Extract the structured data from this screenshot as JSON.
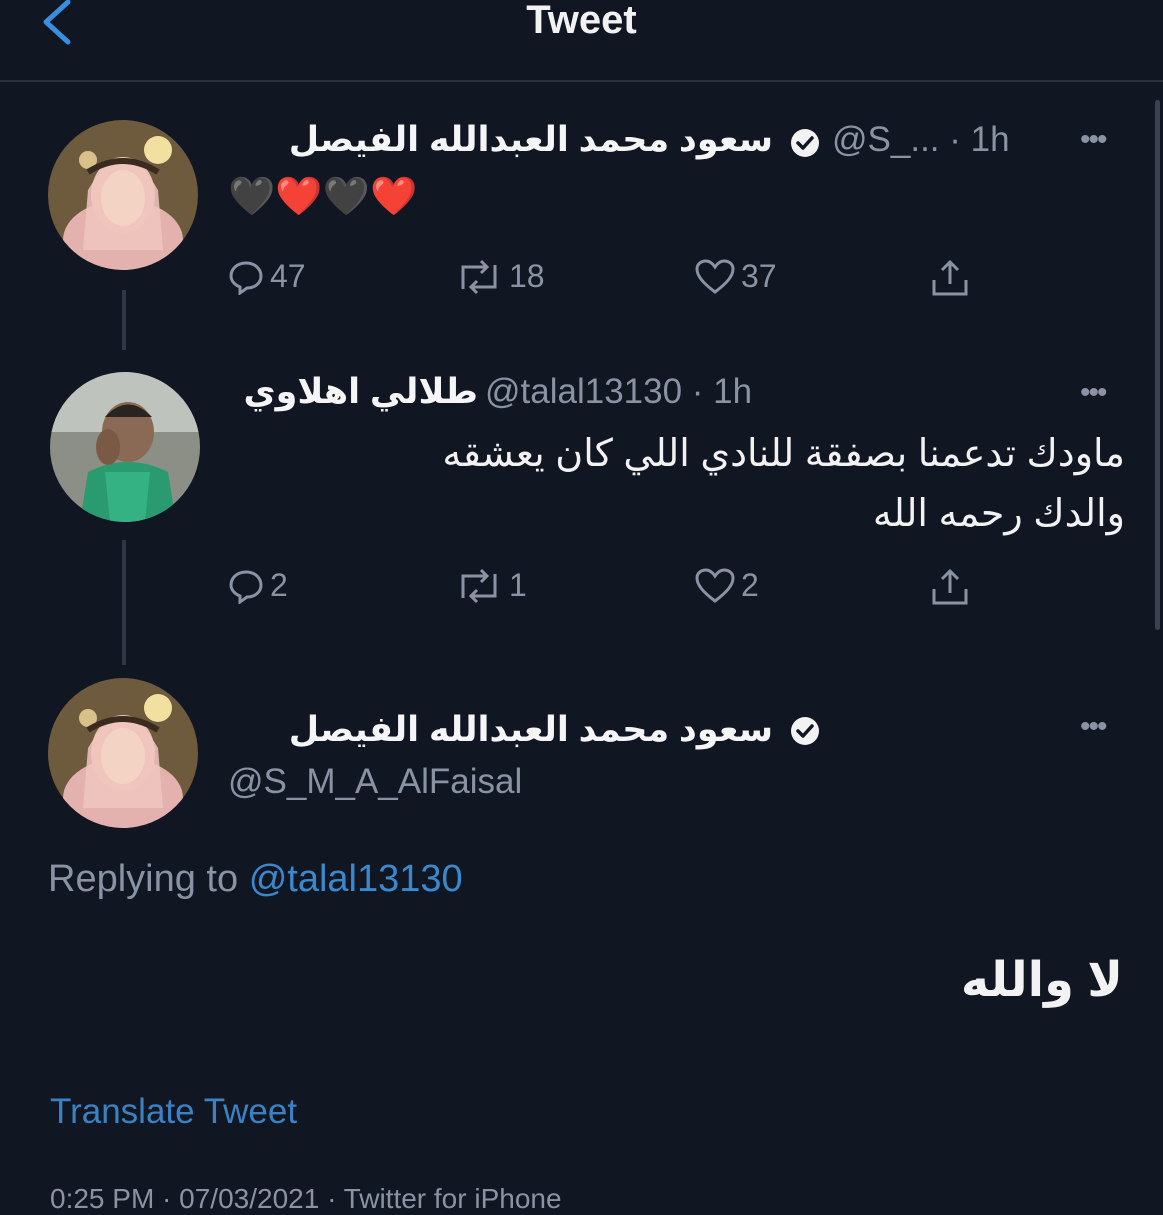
{
  "header": {
    "title": "Tweet"
  },
  "colors": {
    "background": "#111623",
    "link": "#3a89cf",
    "heart": "#e0303a",
    "muted": "#8a93a3"
  },
  "tweet1": {
    "name": "سعود محمد العبدالله الفيصل",
    "handle_time": "@S_... · 1h",
    "emojis": "🖤❤️🖤❤️",
    "replies": "47",
    "retweets": "18",
    "likes": "37"
  },
  "tweet2": {
    "name": "طلالي اهلاوي",
    "handle_time": "@talal13130 · 1h",
    "text_line1": "ماودك تدعمنا بصفقة للنادي اللي كان يعشقه",
    "text_line2": "والدك رحمه الله",
    "replies": "2",
    "retweets": "1",
    "likes": "2"
  },
  "main_tweet": {
    "name": "سعود محمد العبدالله الفيصل",
    "handle": "@S_M_A_AlFaisal",
    "replying_prefix": "Replying to",
    "replying_handle": "@talal13130",
    "text": "لا والله",
    "translate": "Translate Tweet",
    "footer_partial": "0:25 PM · 07/03/2021 · Twitter for iPhone"
  },
  "icons": {
    "back": "chevron-left-icon",
    "verified": "verified-badge-icon",
    "more": "more-dots-icon",
    "reply": "reply-icon",
    "retweet": "retweet-icon",
    "like": "heart-icon",
    "share": "share-icon"
  }
}
